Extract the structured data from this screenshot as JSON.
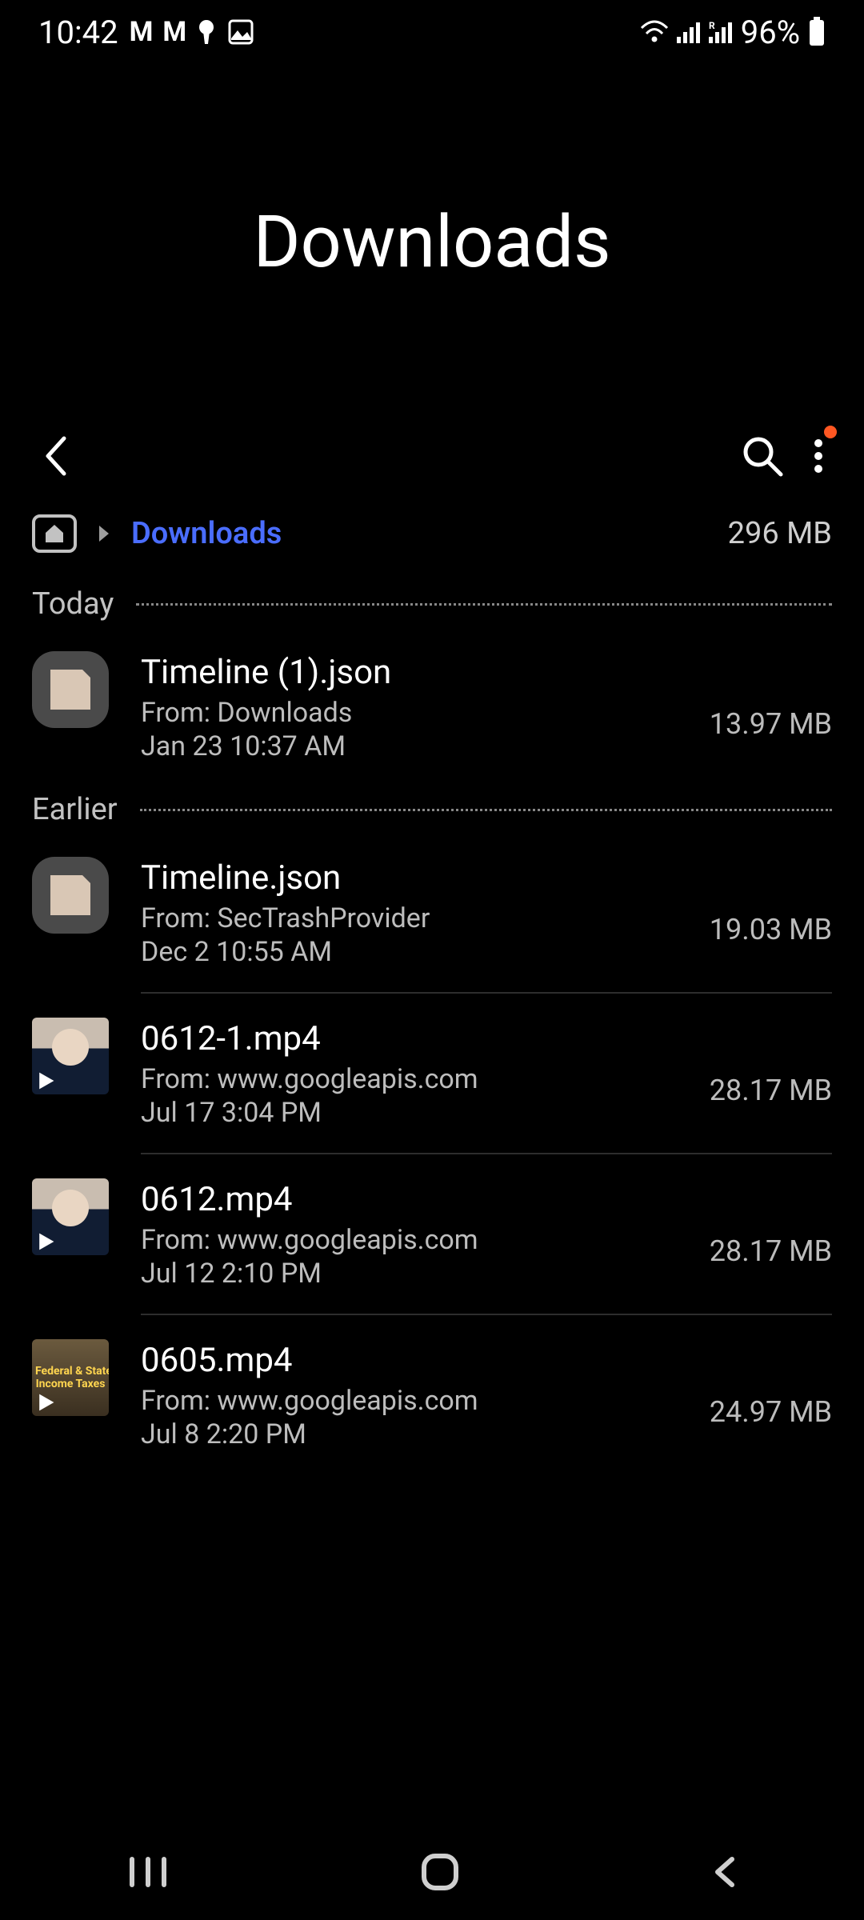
{
  "status": {
    "time": "10:42",
    "battery_text": "96%"
  },
  "page": {
    "title": "Downloads"
  },
  "breadcrumb": {
    "current": "Downloads",
    "total_size": "296 MB"
  },
  "sections": [
    {
      "id": "today",
      "label": "Today",
      "items": [
        {
          "name": "Timeline (1).json",
          "from": "From: Downloads",
          "date": "Jan 23 10:37 AM",
          "size": "13.97 MB",
          "thumb": "doc",
          "divider": false
        }
      ]
    },
    {
      "id": "earlier",
      "label": "Earlier",
      "items": [
        {
          "name": "Timeline.json",
          "from": "From: SecTrashProvider",
          "date": "Dec 2 10:55 AM",
          "size": "19.03 MB",
          "thumb": "doc",
          "divider": true
        },
        {
          "name": "0612-1.mp4",
          "from": "From: www.googleapis.com",
          "date": "Jul 17 3:04 PM",
          "size": "28.17 MB",
          "thumb": "video",
          "divider": true
        },
        {
          "name": "0612.mp4",
          "from": "From: www.googleapis.com",
          "date": "Jul 12 2:10 PM",
          "size": "28.17 MB",
          "thumb": "video",
          "divider": true
        },
        {
          "name": "0605.mp4",
          "from": "From: www.googleapis.com",
          "date": "Jul 8 2:20 PM",
          "size": "24.97 MB",
          "thumb": "video2",
          "divider": false
        }
      ]
    }
  ]
}
